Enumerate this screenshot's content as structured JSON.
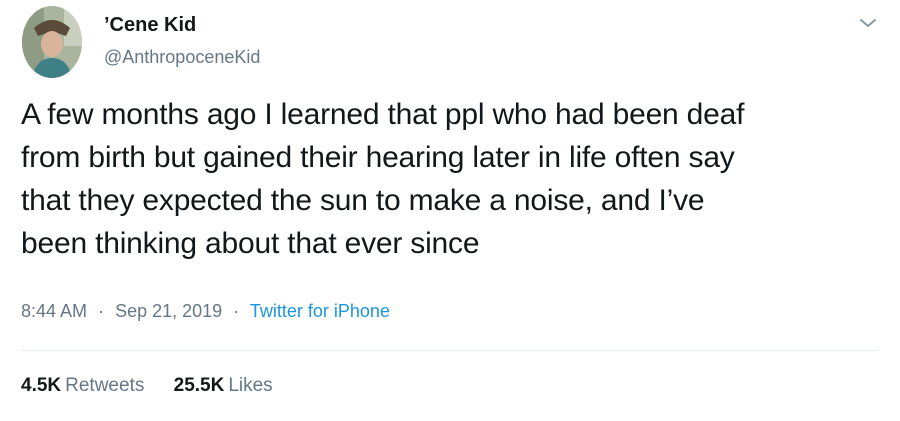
{
  "author": {
    "display_name": "’Cene Kid",
    "handle": "@AnthropoceneKid"
  },
  "tweet": {
    "text": "A few months ago I learned that ppl who had been deaf\nfrom birth but gained their hearing later in life often say\nthat they expected the sun to make a noise, and I’ve\nbeen thinking about that ever since",
    "time": "8:44 AM",
    "separator": "·",
    "date": "Sep 21, 2019",
    "source": "Twitter for iPhone"
  },
  "stats": {
    "retweets_count": "4.5K",
    "retweets_label": "Retweets",
    "likes_count": "25.5K",
    "likes_label": "Likes"
  },
  "icons": {
    "menu_caret": "chevron-down-icon"
  },
  "colors": {
    "text": "#14171a",
    "secondary": "#657786",
    "link": "#1b95e0",
    "divider": "#e6ecf0"
  }
}
